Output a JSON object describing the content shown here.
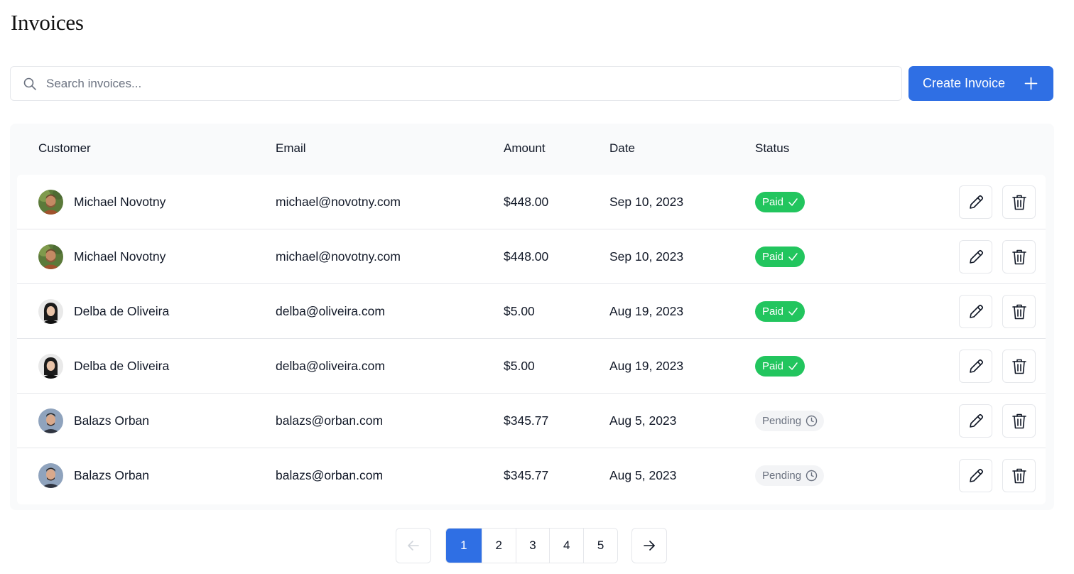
{
  "page": {
    "title": "Invoices"
  },
  "search": {
    "placeholder": "Search invoices...",
    "value": ""
  },
  "toolbar": {
    "create_label": "Create Invoice"
  },
  "table": {
    "headers": {
      "customer": "Customer",
      "email": "Email",
      "amount": "Amount",
      "date": "Date",
      "status": "Status"
    },
    "rows": [
      {
        "name": "Michael Novotny",
        "email": "michael@novotny.com",
        "amount": "$448.00",
        "date": "Sep 10, 2023",
        "status": "Paid",
        "status_kind": "paid",
        "avatar": "michael"
      },
      {
        "name": "Michael Novotny",
        "email": "michael@novotny.com",
        "amount": "$448.00",
        "date": "Sep 10, 2023",
        "status": "Paid",
        "status_kind": "paid",
        "avatar": "michael"
      },
      {
        "name": "Delba de Oliveira",
        "email": "delba@oliveira.com",
        "amount": "$5.00",
        "date": "Aug 19, 2023",
        "status": "Paid",
        "status_kind": "paid",
        "avatar": "delba"
      },
      {
        "name": "Delba de Oliveira",
        "email": "delba@oliveira.com",
        "amount": "$5.00",
        "date": "Aug 19, 2023",
        "status": "Paid",
        "status_kind": "paid",
        "avatar": "delba"
      },
      {
        "name": "Balazs Orban",
        "email": "balazs@orban.com",
        "amount": "$345.77",
        "date": "Aug 5, 2023",
        "status": "Pending",
        "status_kind": "pending",
        "avatar": "balazs"
      },
      {
        "name": "Balazs Orban",
        "email": "balazs@orban.com",
        "amount": "$345.77",
        "date": "Aug 5, 2023",
        "status": "Pending",
        "status_kind": "pending",
        "avatar": "balazs"
      }
    ]
  },
  "pagination": {
    "pages": [
      "1",
      "2",
      "3",
      "4",
      "5"
    ],
    "current": "1"
  },
  "colors": {
    "accent": "#2f6fe4",
    "paid": "#22c55e",
    "pending_bg": "#f3f4f6",
    "pending_text": "#6b7280"
  },
  "icons": {
    "search": "search-icon",
    "plus": "plus-icon",
    "edit": "pencil-icon",
    "delete": "trash-icon",
    "paid": "check-icon",
    "pending": "clock-icon",
    "prev": "arrow-left-icon",
    "next": "arrow-right-icon"
  }
}
